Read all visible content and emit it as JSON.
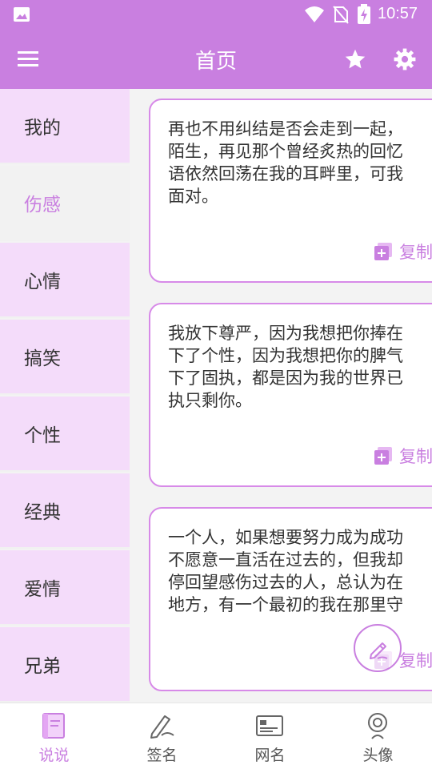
{
  "colors": {
    "accent": "#c97fe0",
    "sidebar_bg": "#f4dcfa",
    "card_border": "#d78ae8",
    "text": "#333333"
  },
  "status_bar": {
    "time": "10:57",
    "icons": [
      "image-icon",
      "wifi-icon",
      "no-sim-icon",
      "battery-charging-icon"
    ]
  },
  "app_bar": {
    "title": "首页",
    "icons": [
      "menu-icon",
      "star-icon",
      "gear-icon"
    ]
  },
  "sidebar": {
    "items": [
      {
        "label": "我的",
        "active": false
      },
      {
        "label": "伤感",
        "active": true
      },
      {
        "label": "心情",
        "active": false
      },
      {
        "label": "搞笑",
        "active": false
      },
      {
        "label": "个性",
        "active": false
      },
      {
        "label": "经典",
        "active": false
      },
      {
        "label": "爱情",
        "active": false
      },
      {
        "label": "兄弟",
        "active": false
      }
    ]
  },
  "cards": [
    {
      "text": "再也不用纠结是否会走到一起，\n陌生，再见那个曾经炙热的回忆\n语依然回荡在我的耳畔里，可我\n面对。",
      "copy_label": "复制"
    },
    {
      "text": "我放下尊严，因为我想把你捧在\n下了个性，因为我想把你的脾气\n下了固执，都是因为我的世界已\n执只剩你。",
      "copy_label": "复制"
    },
    {
      "text": "一个人，如果想要努力成为成功\n不愿意一直活在过去的，但我却\n停回望感伤过去的人，总认为在\n地方，有一个最初的我在那里守",
      "copy_label": "复制"
    }
  ],
  "fab": {
    "icon": "edit-pen-icon"
  },
  "bottom_nav": {
    "items": [
      {
        "label": "说说",
        "icon": "book-icon",
        "active": true
      },
      {
        "label": "签名",
        "icon": "signature-icon",
        "active": false
      },
      {
        "label": "网名",
        "icon": "id-card-icon",
        "active": false
      },
      {
        "label": "头像",
        "icon": "avatar-icon",
        "active": false
      }
    ]
  }
}
